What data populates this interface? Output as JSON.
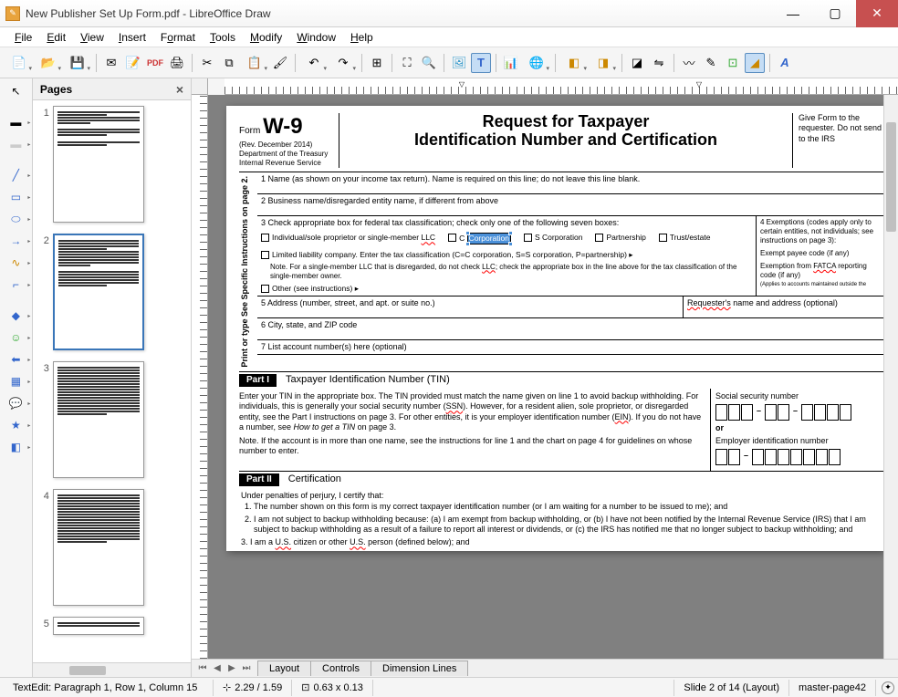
{
  "titlebar": {
    "text": "New Publisher Set Up Form.pdf - LibreOffice Draw"
  },
  "menu": {
    "items": [
      "File",
      "Edit",
      "View",
      "Insert",
      "Format",
      "Tools",
      "Modify",
      "Window",
      "Help"
    ]
  },
  "pages_panel": {
    "title": "Pages",
    "page_count": 5,
    "selected": 2
  },
  "tabs": {
    "items": [
      "Layout",
      "Controls",
      "Dimension Lines"
    ]
  },
  "statusbar": {
    "edit_info": "TextEdit: Paragraph 1, Row 1, Column 15",
    "pos": "2.29 / 1.59",
    "size": "0.63 x 0.13",
    "slide": "Slide 2 of 14 (Layout)",
    "master": "master-page42"
  },
  "form": {
    "id_prefix": "Form",
    "id": "W-9",
    "rev": "(Rev. December 2014)",
    "dept": "Department of the Treasury",
    "irs": "Internal Revenue Service",
    "title_l1": "Request for Taxpayer",
    "title_l2": "Identification Number and Certification",
    "instruct_right": "Give Form to the requester. Do not send to the IRS",
    "sidebar": "Print or type\nSee Specific Instructions on page 2.",
    "line1": "1  Name (as shown on your income tax return). Name is required on this line; do not leave this line blank.",
    "line2": "2  Business name/disregarded entity name, if different from above",
    "line3": "3  Check appropriate box for federal tax classification; check only one of the following seven boxes:",
    "chk_individual": "Individual/sole proprietor or single-member ",
    "chk_individual_llc": "LLC",
    "chk_c": "C ",
    "chk_c_sel": "Corporation",
    "chk_s": "S Corporation",
    "chk_partnership": "Partnership",
    "chk_trust": "Trust/estate",
    "chk_llc": "Limited liability company. Enter the tax classification (C=C corporation, S=S corporation, P=partnership) ▸",
    "note_llc": "Note. For a single-member LLC that is disregarded, do not check LLC; check the appropriate box in the line above for the tax classification of the single-member owner.",
    "chk_other": "Other (see instructions) ▸",
    "exempt_title": "4  Exemptions (codes apply only to certain entities, not individuals; see instructions on page 3):",
    "exempt_payee": "Exempt payee code (if any)",
    "exempt_fatca": "Exemption from FATCA reporting code (if any)",
    "exempt_note": "(Applies to accounts maintained outside the",
    "line5": "5  Address (number, street, and apt. or suite no.)",
    "requester": "Requester's name and address (optional)",
    "line6": "6  City, state, and ZIP code",
    "line7": "7  List account number(s) here (optional)",
    "part1_label": "Part I",
    "part1_title": "Taxpayer Identification Number (TIN)",
    "part1_text1": "Enter your TIN in the appropriate box. The TIN provided must match the name given on line 1 to avoid backup withholding. For individuals, this is generally your social security number (SSN). However, for a resident alien, sole proprietor, or disregarded entity, see the Part I instructions on page 3. For other entities, it is your employer identification number (EIN). If you do not have a number, see How to get a TIN on page 3.",
    "part1_text2": "Note. If the account is in more than one name, see the instructions for line 1 and the chart on page 4 for guidelines on whose number to enter.",
    "ssn_label": "Social security number",
    "or": "or",
    "ein_label": "Employer identification number",
    "part2_label": "Part II",
    "part2_title": "Certification",
    "cert_intro": "Under penalties of perjury, I certify that:",
    "cert1": "The number shown on this form is my correct taxpayer identification number (or I am waiting for a number to be issued to me); and",
    "cert2": "I am not subject to backup withholding because: (a) I am exempt from backup withholding, or (b) I have not been notified by the Internal Revenue Service (IRS) that I am subject to backup withholding as a result of a failure to report all interest or dividends, or (c) the IRS has notified me that no longer subject to backup withholding; and",
    "cert3": "I am a U.S. citizen or other U.S. person (defined below); and"
  }
}
